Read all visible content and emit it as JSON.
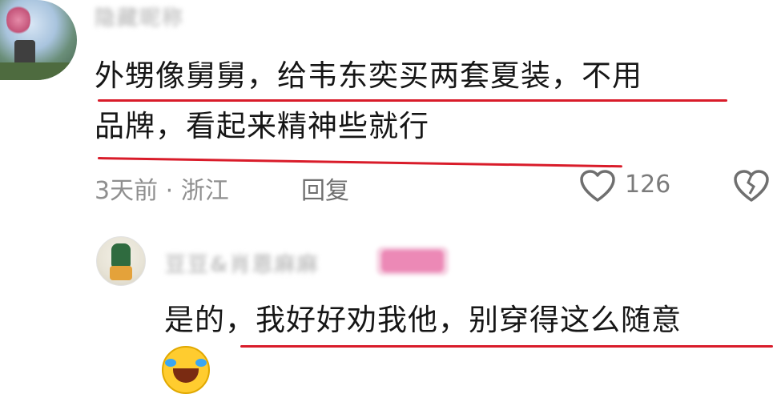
{
  "comment1": {
    "username_blurred": "隐藏昵称",
    "text_line1": "外甥像舅舅，给韦东奕买两套夏装，不用",
    "text_line2": "品牌，看起来精神些就行",
    "time_location": "3天前 · 浙江",
    "reply_label": "回复",
    "like_count": "126",
    "icons": {
      "like": "heart-outline-icon",
      "dislike": "broken-heart-icon"
    }
  },
  "reply1": {
    "username_blurred": "豆豆&肖恩麻麻",
    "badge_blurred": "作者",
    "text": "是的，我好好劝我他，别穿得这么随意",
    "emoji": "laughing-crying-emoji"
  },
  "colors": {
    "underline": "#d91c2a",
    "meta_text": "#8f8f8f",
    "badge": "#e86aa4"
  }
}
